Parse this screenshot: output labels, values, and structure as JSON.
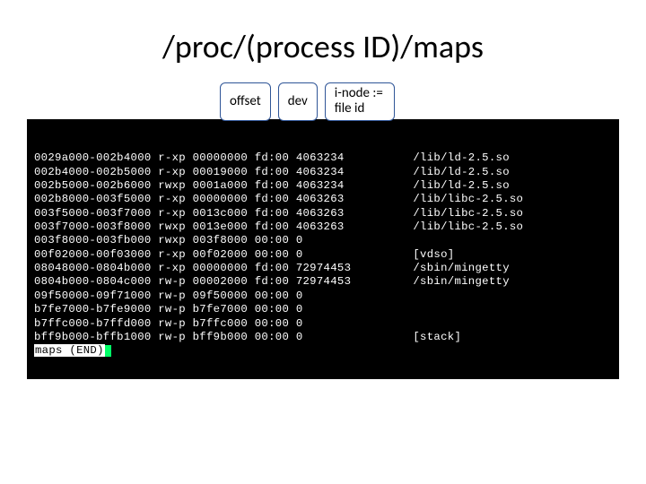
{
  "title": "/proc/(process ID)/maps",
  "labels": {
    "offset": "offset",
    "dev": "dev",
    "inode": "i-node  :=\nfile id"
  },
  "rows": [
    {
      "addr": "0029a000-002b4000",
      "perm": "r-xp",
      "off": "00000000",
      "dev": "fd:00",
      "ino": "4063234",
      "path": "/lib/ld-2.5.so"
    },
    {
      "addr": "002b4000-002b5000",
      "perm": "r-xp",
      "off": "00019000",
      "dev": "fd:00",
      "ino": "4063234",
      "path": "/lib/ld-2.5.so"
    },
    {
      "addr": "002b5000-002b6000",
      "perm": "rwxp",
      "off": "0001a000",
      "dev": "fd:00",
      "ino": "4063234",
      "path": "/lib/ld-2.5.so"
    },
    {
      "addr": "002b8000-003f5000",
      "perm": "r-xp",
      "off": "00000000",
      "dev": "fd:00",
      "ino": "4063263",
      "path": "/lib/libc-2.5.so"
    },
    {
      "addr": "003f5000-003f7000",
      "perm": "r-xp",
      "off": "0013c000",
      "dev": "fd:00",
      "ino": "4063263",
      "path": "/lib/libc-2.5.so"
    },
    {
      "addr": "003f7000-003f8000",
      "perm": "rwxp",
      "off": "0013e000",
      "dev": "fd:00",
      "ino": "4063263",
      "path": "/lib/libc-2.5.so"
    },
    {
      "addr": "003f8000-003fb000",
      "perm": "rwxp",
      "off": "003f8000",
      "dev": "00:00",
      "ino": "0",
      "path": ""
    },
    {
      "addr": "00f02000-00f03000",
      "perm": "r-xp",
      "off": "00f02000",
      "dev": "00:00",
      "ino": "0",
      "path": "[vdso]"
    },
    {
      "addr": "08048000-0804b000",
      "perm": "r-xp",
      "off": "00000000",
      "dev": "fd:00",
      "ino": "72974453",
      "path": "/sbin/mingetty"
    },
    {
      "addr": "0804b000-0804c000",
      "perm": "rw-p",
      "off": "00002000",
      "dev": "fd:00",
      "ino": "72974453",
      "path": "/sbin/mingetty"
    },
    {
      "addr": "09f50000-09f71000",
      "perm": "rw-p",
      "off": "09f50000",
      "dev": "00:00",
      "ino": "0",
      "path": ""
    },
    {
      "addr": "b7fe7000-b7fe9000",
      "perm": "rw-p",
      "off": "b7fe7000",
      "dev": "00:00",
      "ino": "0",
      "path": ""
    },
    {
      "addr": "b7ffc000-b7ffd000",
      "perm": "rw-p",
      "off": "b7ffc000",
      "dev": "00:00",
      "ino": "0",
      "path": ""
    },
    {
      "addr": "bff9b000-bffb1000",
      "perm": "rw-p",
      "off": "bff9b000",
      "dev": "00:00",
      "ino": "0",
      "path": "[stack]"
    }
  ],
  "pager": "maps (END)"
}
